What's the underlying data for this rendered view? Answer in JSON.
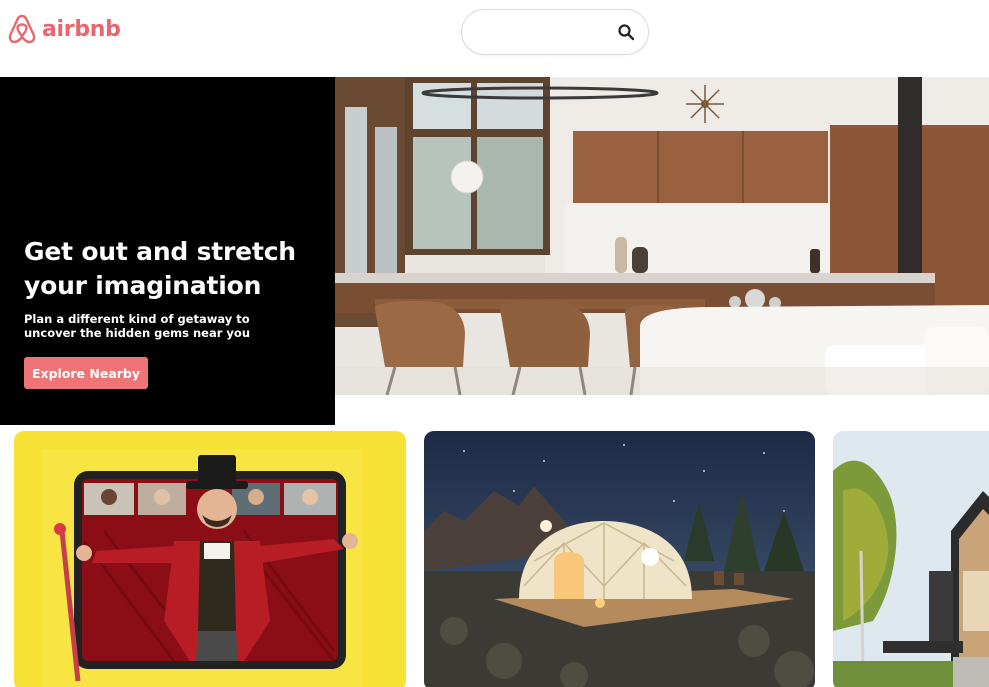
{
  "brand": {
    "name": "airbnb",
    "color": "#e8676e"
  },
  "search": {
    "value": "",
    "placeholder": ""
  },
  "hero": {
    "title": "Get out and stretch your imagination",
    "subtitle": "Plan a different kind of getaway to uncover the hidden gems near you",
    "button_label": "Explore Nearby",
    "button_color": "#ee7478",
    "image_icon": "modern-kitchen-dining-photo"
  },
  "cards": [
    {
      "icon": "ringmaster-video-call-photo"
    },
    {
      "icon": "geodesic-dome-night-photo"
    },
    {
      "icon": "modern-cabin-forest-photo"
    }
  ]
}
